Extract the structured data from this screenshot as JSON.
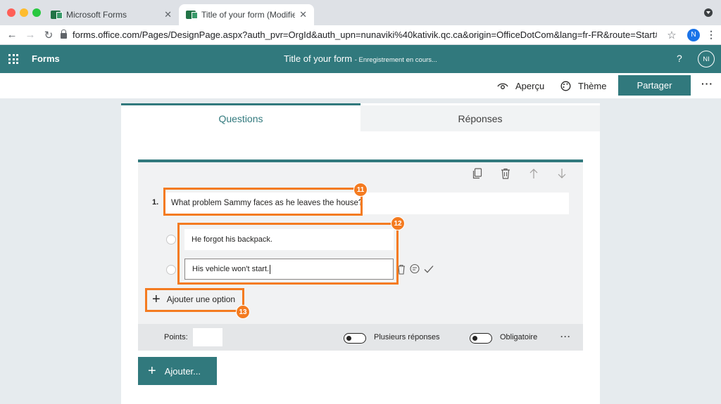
{
  "browser": {
    "tabs": [
      {
        "label": "Microsoft Forms",
        "close": "✕"
      },
      {
        "label": "Title of your form (Modifier) Mi",
        "close": "✕"
      }
    ],
    "url": "forms.office.com/Pages/DesignPage.aspx?auth_pvr=OrgId&auth_upn=nunaviki%40kativik.qc.ca&origin=OfficeDotCom&lang=fr-FR&route=Start#FormId...",
    "profile_initial": "N"
  },
  "app": {
    "name": "Forms",
    "doc_title": "Title of your form",
    "doc_status": "- Enregistrement en cours...",
    "help": "?",
    "avatar": "NI"
  },
  "commands": {
    "preview": "Aperçu",
    "theme": "Thème",
    "share": "Partager",
    "more": "···"
  },
  "tabs": {
    "questions": "Questions",
    "responses": "Réponses"
  },
  "question": {
    "number": "1.",
    "title": "What problem Sammy faces as he leaves the house?",
    "options": [
      "He forgot his backpack.",
      "His vehicle won't start."
    ],
    "add_option": "Ajouter une option",
    "points_label": "Points:",
    "multiple_answers": "Plusieurs réponses",
    "required": "Obligatoire",
    "more": "···"
  },
  "add_button": "Ajouter...",
  "annotations": [
    "11",
    "12",
    "13"
  ],
  "colors": {
    "brand": "#31797d",
    "annotation": "#f47b20"
  }
}
